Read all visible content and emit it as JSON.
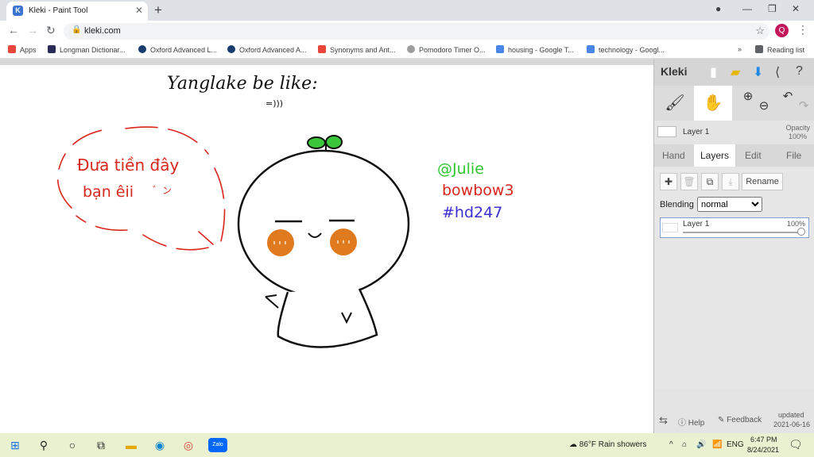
{
  "browser": {
    "tab_title": "Kleki - Paint Tool",
    "tab_favicon": "K",
    "url": "kleki.com",
    "profile_initial": "Q",
    "reading_list": "Reading list",
    "overflow": "»"
  },
  "bookmarks": [
    {
      "label": "Apps",
      "color": "#e8453c"
    },
    {
      "label": "Longman Dictionar...",
      "color": "#2a2a5a"
    },
    {
      "label": "Oxford Advanced L...",
      "color": "#1a3b6e"
    },
    {
      "label": "Oxford Advanced A...",
      "color": "#1a3b6e"
    },
    {
      "label": "Synonyms and Ant...",
      "color": "#e8453c"
    },
    {
      "label": "Pomodoro Timer O...",
      "color": "#9e9e9e"
    },
    {
      "label": "housing - Google T...",
      "color": "#4a86e8"
    },
    {
      "label": "technology - Googl...",
      "color": "#4a86e8"
    }
  ],
  "drawing": {
    "title": "Yanglake be like:",
    "face_note": "=)))",
    "speech_line1": "Đưa tiền đây",
    "speech_line2": "bạn êii",
    "speech_smiley": "゛ン",
    "credit1": "@Julie",
    "credit2": "bowbow3",
    "credit3": "#hd247",
    "credit1_color": "#2ec72e",
    "credit2_color": "#d9261c",
    "credit3_color": "#3b2fd1",
    "cheek_color": "#e07a1f",
    "sprout_color": "#3bc73b"
  },
  "sidebar": {
    "logo": "Kleki",
    "layer_name": "Layer 1",
    "opacity_label": "Opacity",
    "opacity_value": "100%",
    "tabs": [
      "Hand",
      "Layers",
      "Edit",
      "File"
    ],
    "rename": "Rename",
    "blending_label": "Blending",
    "blending_value": "normal",
    "layer_row_name": "Layer 1",
    "layer_row_opacity": "100%",
    "help": "Help",
    "feedback": "Feedback",
    "updated_label": "updated",
    "updated_date": "2021-06-16"
  },
  "taskbar": {
    "weather": "86°F  Rain showers",
    "lang": "ENG",
    "time": "6:47 PM",
    "date": "8/24/2021",
    "app_zalo": "Zalo"
  }
}
